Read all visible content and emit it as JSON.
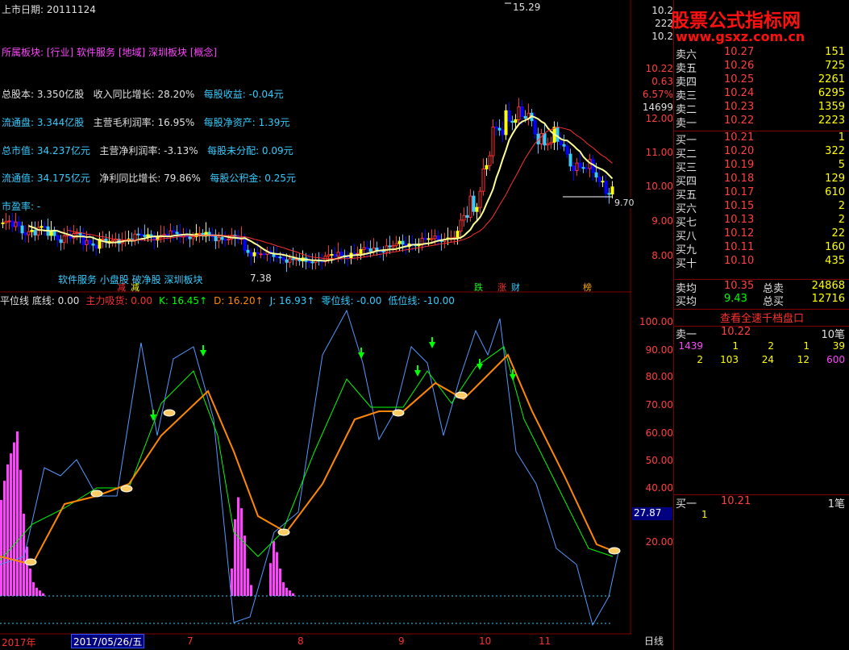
{
  "header": {
    "listed_date": "上市日期: 20111124",
    "sector": "所属板块: [行业] 软件服务 [地域] 深圳板块 [概念]"
  },
  "fundamentals": [
    [
      "总股本: 3.350亿股",
      "收入同比增长: 28.20%",
      "每股收益: -0.04元"
    ],
    [
      "流通盘: 3.344亿股",
      "主营毛利润率: 16.95%",
      "每股净资产: 1.39元"
    ],
    [
      "总市值: 34.237亿元",
      "主营净利润率: -3.13%",
      "每股未分配: 0.09元"
    ],
    [
      "流通值: 34.175亿元",
      "净利同比增长: 79.86%",
      "每股公积金: 0.25元"
    ]
  ],
  "pe_line": "市盈率: -",
  "tags_line": "软件服务 小盘股 破净股 深圳板块",
  "price_annotations": {
    "high": "15.29",
    "low": "7.38",
    "last": "9.70",
    "markers": [
      "减",
      "跌",
      "涨",
      "财",
      "榜"
    ]
  },
  "price_axis": [
    "12.00",
    "11.00",
    "10.00",
    "9.00",
    "8.00"
  ],
  "ind_header": [
    {
      "text": "平位线 底线: 0.00",
      "color": "#e0e0e0"
    },
    {
      "text": "主力吸货: 0.00",
      "color": "#ff3030"
    },
    {
      "text": "K: 16.45↑",
      "color": "#00ff00"
    },
    {
      "text": "D: 16.20↑",
      "color": "#ff8800"
    },
    {
      "text": "J: 16.93↑",
      "color": "#33ccff"
    },
    {
      "text": "零位线: -0.00",
      "color": "#33ccff"
    },
    {
      "text": "低位线: -10.00",
      "color": "#33ccff"
    }
  ],
  "ind_axis": [
    "100.00",
    "90.00",
    "80.00",
    "70.00",
    "60.00",
    "50.00",
    "40.00",
    "20.00"
  ],
  "ind_current": "27.87",
  "date_bar": {
    "year": "2017年",
    "cursor": "2017/05/26/五",
    "months": [
      "7",
      "8",
      "9",
      "10",
      "11"
    ],
    "period_button": "日线"
  },
  "left_axis_top": [
    "10.2",
    "222",
    "10.2",
    "10.22",
    "0.63",
    "6.57%",
    "14699"
  ],
  "watermark": {
    "title": "股票公式指标网",
    "url": "www.gsxz.com.cn"
  },
  "order_book": {
    "asks": [
      {
        "label": "卖六",
        "price": "10.27",
        "vol": "151"
      },
      {
        "label": "卖五",
        "price": "10.26",
        "vol": "725"
      },
      {
        "label": "卖四",
        "price": "10.25",
        "vol": "2261"
      },
      {
        "label": "卖三",
        "price": "10.24",
        "vol": "6295"
      },
      {
        "label": "卖二",
        "price": "10.23",
        "vol": "1359"
      },
      {
        "label": "卖一",
        "price": "10.22",
        "vol": "2223"
      }
    ],
    "bids": [
      {
        "label": "买一",
        "price": "10.21",
        "vol": "1"
      },
      {
        "label": "买二",
        "price": "10.20",
        "vol": "322"
      },
      {
        "label": "买三",
        "price": "10.19",
        "vol": "5"
      },
      {
        "label": "买四",
        "price": "10.18",
        "vol": "129"
      },
      {
        "label": "买五",
        "price": "10.17",
        "vol": "610"
      },
      {
        "label": "买六",
        "price": "10.15",
        "vol": "2"
      },
      {
        "label": "买七",
        "price": "10.13",
        "vol": "2"
      },
      {
        "label": "买八",
        "price": "10.12",
        "vol": "22"
      },
      {
        "label": "买九",
        "price": "10.11",
        "vol": "160"
      },
      {
        "label": "买十",
        "price": "10.10",
        "vol": "435"
      }
    ],
    "avg_sell": {
      "label": "卖均",
      "price": "10.35",
      "tlabel": "总卖",
      "total": "24868"
    },
    "avg_buy": {
      "label": "买均",
      "price": "9.43",
      "tlabel": "总买",
      "total": "12716"
    },
    "quick_button": "查看全速千档盘口",
    "ask1_detail": {
      "label": "卖一",
      "price": "10.22",
      "count": "10笔"
    },
    "ask1_orders": [
      "1439",
      "1",
      "2",
      "1",
      "39",
      "2",
      "103",
      "24",
      "12",
      "600"
    ],
    "bid1_detail": {
      "label": "买一",
      "price": "10.21",
      "count": "1笔"
    },
    "bid1_orders": [
      "1"
    ]
  },
  "colors": {
    "up": "#ff3030",
    "down": "#00ff00",
    "k_line": "#00ff00",
    "d_line": "#ff8800",
    "j_line": "#33ccff",
    "volume_bars": "#ff44ff"
  }
}
